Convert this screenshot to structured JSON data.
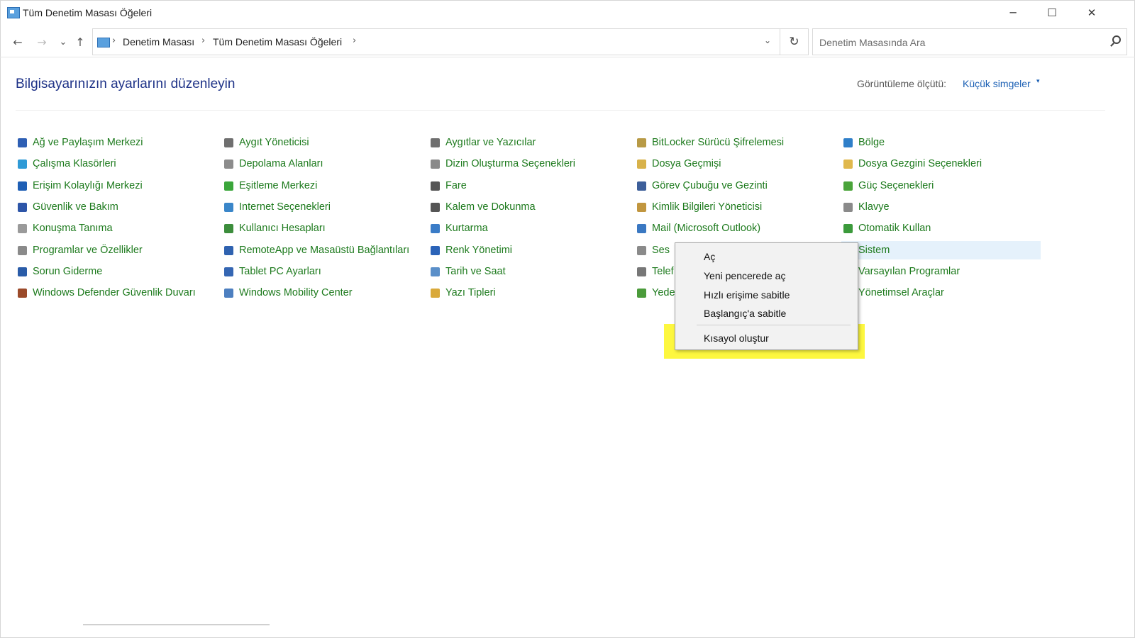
{
  "window": {
    "title": "Tüm Denetim Masası Öğeleri",
    "minimize": "─",
    "maximize": "☐",
    "close": "✕"
  },
  "nav": {
    "back": "←",
    "forward": "→",
    "recent": "⌄",
    "up": "↑",
    "crumbs": [
      "Denetim Masası",
      "Tüm Denetim Masası Öğeleri"
    ],
    "separator": "›",
    "dropdown": "⌄",
    "refresh": "↻"
  },
  "search": {
    "placeholder": "Denetim Masasında Ara"
  },
  "header": {
    "heading": "Bilgisayarınızın ayarlarını düzenleyin",
    "view_label": "Görüntüleme ölçütü:",
    "view_value": "Küçük simgeler",
    "view_arrow": "▾"
  },
  "columns": [
    [
      {
        "label": "Ağ ve Paylaşım Merkezi",
        "icon": "network-icon",
        "color": "#2e5fb4"
      },
      {
        "label": "Çalışma Klasörleri",
        "icon": "work-folders-icon",
        "color": "#2f9ad6"
      },
      {
        "label": "Erişim Kolaylığı Merkezi",
        "icon": "accessibility-icon",
        "color": "#1f5fb5"
      },
      {
        "label": "Güvenlik ve Bakım",
        "icon": "flag-icon",
        "color": "#2d55a8"
      },
      {
        "label": "Konuşma Tanıma",
        "icon": "microphone-icon",
        "color": "#9a9a9a"
      },
      {
        "label": "Programlar ve Özellikler",
        "icon": "programs-icon",
        "color": "#8a8a8a"
      },
      {
        "label": "Sorun Giderme",
        "icon": "troubleshoot-icon",
        "color": "#2a5ca8"
      },
      {
        "label": "Windows Defender Güvenlik Duvarı",
        "icon": "firewall-icon",
        "color": "#9b4a2a"
      }
    ],
    [
      {
        "label": "Aygıt Yöneticisi",
        "icon": "device-manager-icon",
        "color": "#6f6f6f"
      },
      {
        "label": "Depolama Alanları",
        "icon": "storage-icon",
        "color": "#8c8c8c"
      },
      {
        "label": "Eşitleme Merkezi",
        "icon": "sync-icon",
        "color": "#3ba63b"
      },
      {
        "label": "Internet Seçenekleri",
        "icon": "internet-options-icon",
        "color": "#3a86c9"
      },
      {
        "label": "Kullanıcı Hesapları",
        "icon": "users-icon",
        "color": "#3c8d3c"
      },
      {
        "label": "RemoteApp ve Masaüstü Bağlantıları",
        "icon": "remoteapp-icon",
        "color": "#2f62b0"
      },
      {
        "label": "Tablet PC Ayarları",
        "icon": "tablet-icon",
        "color": "#3566b3"
      },
      {
        "label": "Windows Mobility Center",
        "icon": "mobility-icon",
        "color": "#4d7fc0"
      }
    ],
    [
      {
        "label": "Aygıtlar ve Yazıcılar",
        "icon": "printer-icon",
        "color": "#6f6f6f"
      },
      {
        "label": "Dizin Oluşturma Seçenekleri",
        "icon": "indexing-icon",
        "color": "#8a8a8a"
      },
      {
        "label": "Fare",
        "icon": "mouse-icon",
        "color": "#555555"
      },
      {
        "label": "Kalem ve Dokunma",
        "icon": "pen-icon",
        "color": "#555555"
      },
      {
        "label": "Kurtarma",
        "icon": "recovery-icon",
        "color": "#3a7cc7"
      },
      {
        "label": "Renk Yönetimi",
        "icon": "color-management-icon",
        "color": "#2b63b8"
      },
      {
        "label": "Tarih ve Saat",
        "icon": "date-time-icon",
        "color": "#5a8fc9"
      },
      {
        "label": "Yazı Tipleri",
        "icon": "fonts-icon",
        "color": "#d9a93a"
      }
    ],
    [
      {
        "label": "BitLocker Sürücü Şifrelemesi",
        "icon": "bitlocker-icon",
        "color": "#b89a46"
      },
      {
        "label": "Dosya Geçmişi",
        "icon": "file-history-icon",
        "color": "#d8b24a"
      },
      {
        "label": "Görev Çubuğu ve Gezinti",
        "icon": "taskbar-icon",
        "color": "#3d5f9a"
      },
      {
        "label": "Kimlik Bilgileri Yöneticisi",
        "icon": "credentials-icon",
        "color": "#c1963f"
      },
      {
        "label": "Mail (Microsoft Outlook)",
        "icon": "mail-icon",
        "color": "#3a78c2"
      },
      {
        "label": "Ses",
        "icon": "sound-icon",
        "color": "#8a8a8a"
      },
      {
        "label": "Telef",
        "icon": "phone-icon",
        "color": "#777777"
      },
      {
        "label": "Yede",
        "icon": "backup-icon",
        "color": "#4b9b3b"
      }
    ],
    [
      {
        "label": "Bölge",
        "icon": "region-icon",
        "color": "#2f7fc9"
      },
      {
        "label": "Dosya Gezgini Seçenekleri",
        "icon": "folder-options-icon",
        "color": "#e0b84c"
      },
      {
        "label": "Güç Seçenekleri",
        "icon": "power-icon",
        "color": "#4aa43a"
      },
      {
        "label": "Klavye",
        "icon": "keyboard-icon",
        "color": "#8a8a8a"
      },
      {
        "label": "Otomatik Kullan",
        "icon": "autoplay-icon",
        "color": "#3b9a3b"
      },
      {
        "label": "Sistem",
        "icon": "system-icon",
        "color": "#3a6fb8"
      },
      {
        "label": "Varsayılan Programlar",
        "icon": "default-programs-icon",
        "color": "#3a9a3a"
      },
      {
        "label": "Yönetimsel Araçlar",
        "icon": "admin-tools-icon",
        "color": "#7a7a7a"
      }
    ]
  ],
  "context_menu": {
    "items": [
      "Aç",
      "Yeni pencerede aç",
      "Hızlı erişime sabitle",
      "Başlangıç'a sabitle"
    ],
    "create_shortcut": "Kısayol oluştur",
    "highlight_color": "#fdf73f"
  }
}
